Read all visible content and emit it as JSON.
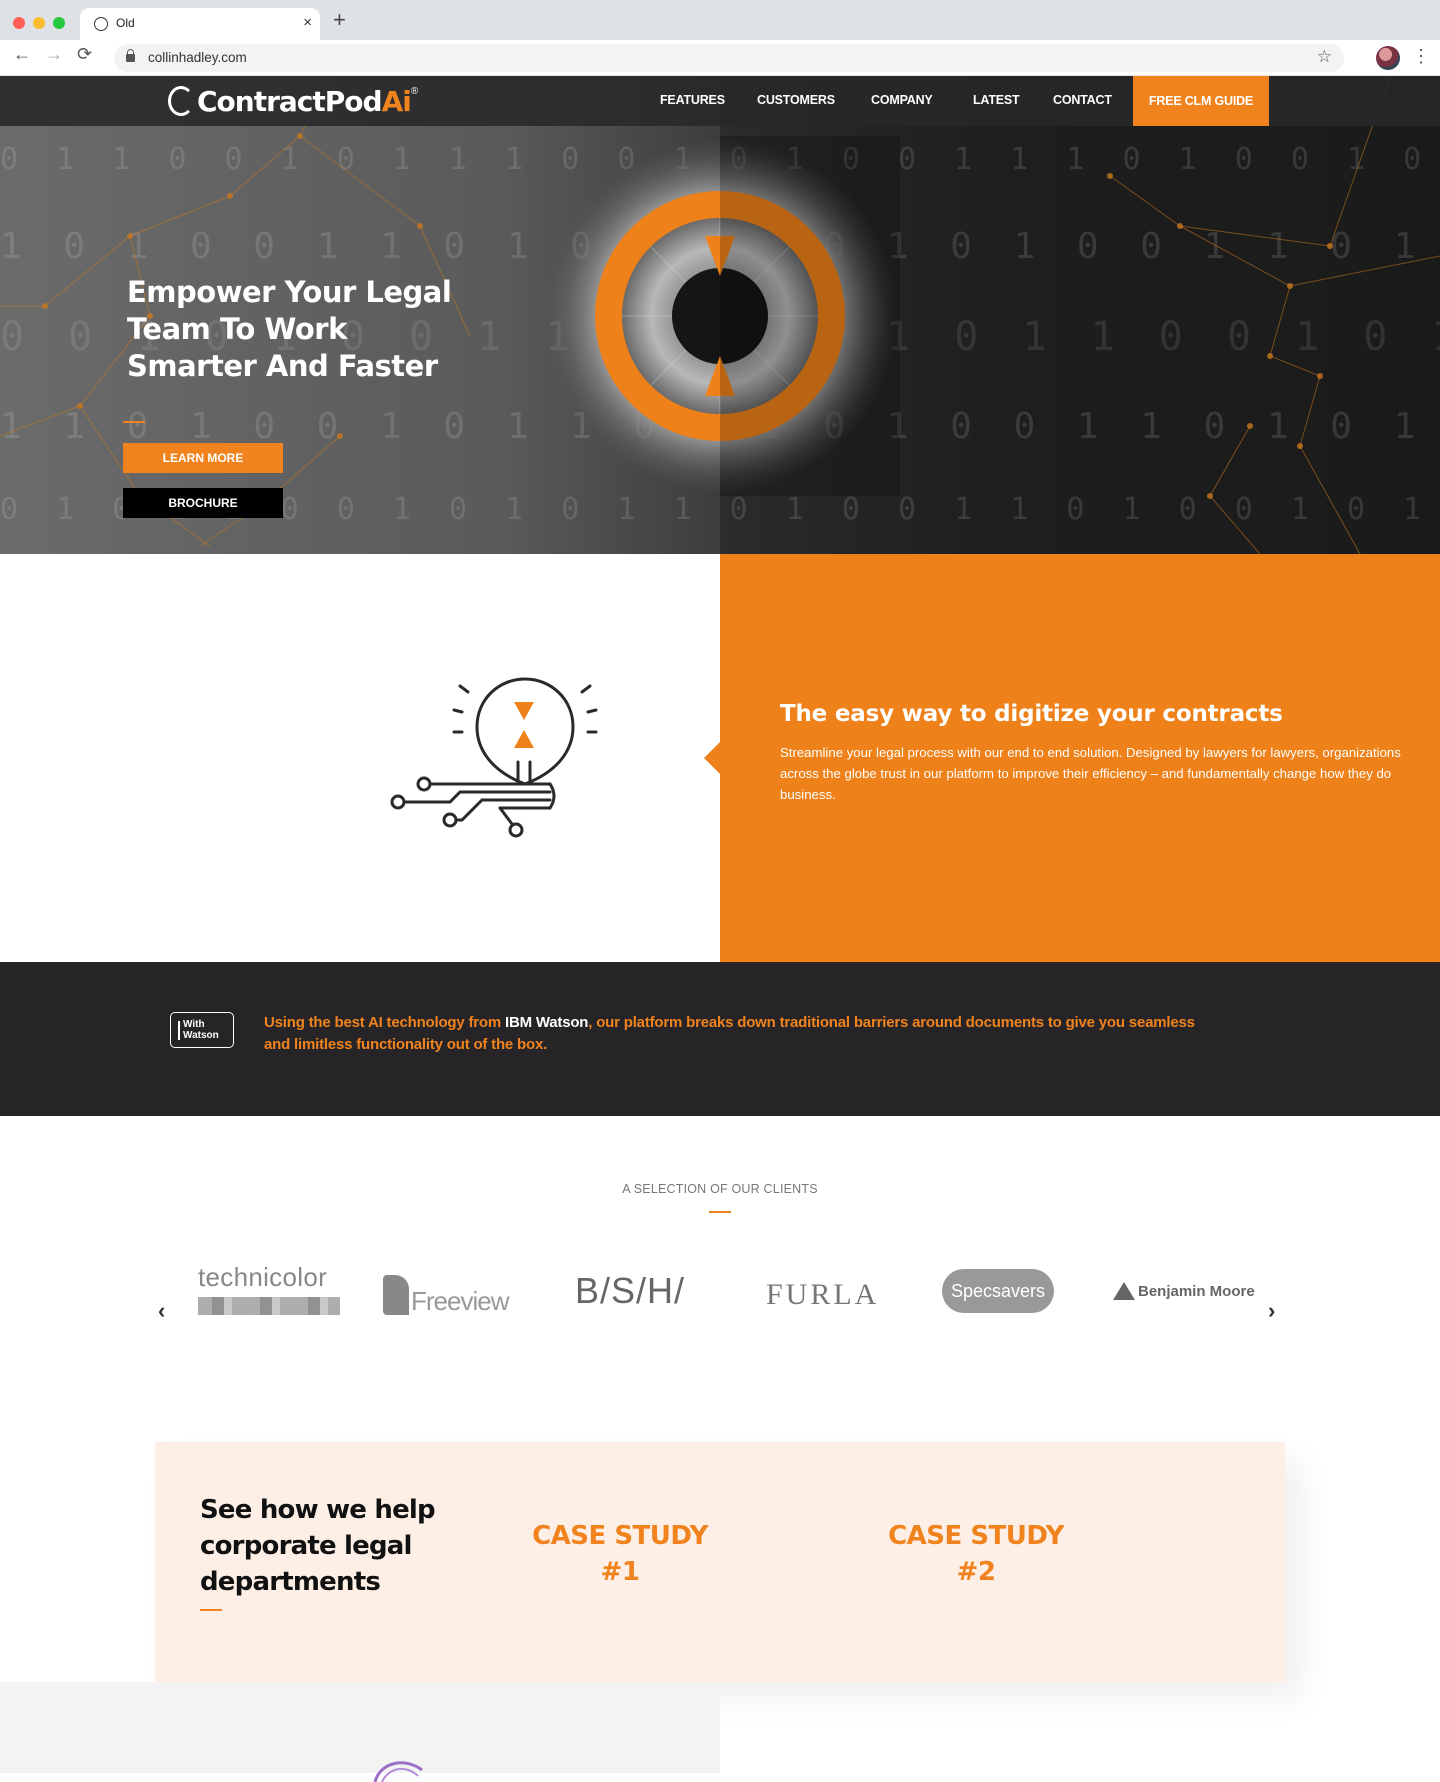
{
  "browser": {
    "tab_title": "Old",
    "url": "collinhadley.com",
    "close_glyph": "×",
    "new_tab_glyph": "+",
    "back_glyph": "←",
    "forward_glyph": "→",
    "reload_glyph": "⟳",
    "star_glyph": "☆",
    "menu_glyph": "⋮"
  },
  "header": {
    "logo_main": "ContractPod",
    "logo_ai": "Ai",
    "logo_reg": "®",
    "nav": [
      "FEATURES",
      "CUSTOMERS",
      "COMPANY",
      "LATEST",
      "CONTACT"
    ],
    "cta": "FREE CLM GUIDE"
  },
  "hero": {
    "title": "Empower Your Legal Team To Work Smarter And Faster",
    "learn_more": "LEARN MORE",
    "brochure": "BROCHURE"
  },
  "feature": {
    "title": "The easy way to digitize your contracts",
    "body": "Streamline your legal process with our end to end solution. Designed by lawyers for lawyers, organizations across the globe trust in our platform to improve their efficiency – and fundamentally change how they do business."
  },
  "watson": {
    "badge_line1": "With",
    "badge_line2": "Watson",
    "text_before": "Using the best AI technology from ",
    "text_highlight": "IBM Watson",
    "text_after": ", our platform breaks down traditional barriers around documents to give you seamless and limitless functionality out of the box."
  },
  "clients": {
    "label": "A SELECTION OF OUR CLIENTS",
    "prev_glyph": "‹",
    "next_glyph": "›",
    "logos": [
      "technicolor",
      "Freeview",
      "B/S/H/",
      "FURLA",
      "Specsavers",
      "Benjamin Moore"
    ]
  },
  "case": {
    "heading": "See how we help corporate legal departments",
    "study1": "CASE STUDY #1",
    "study2": "CASE STUDY #2"
  },
  "colors": {
    "accent": "#f0831d",
    "dark": "#262426",
    "case_bg": "#fdefe6"
  }
}
